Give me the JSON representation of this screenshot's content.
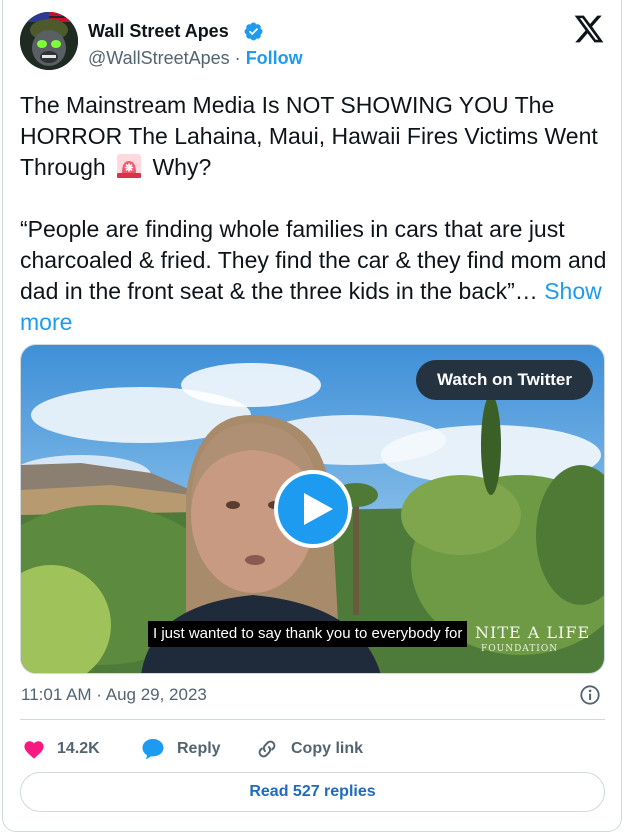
{
  "header": {
    "display_name": "Wall Street Apes",
    "handle": "@WallStreetApes",
    "separator": "·",
    "follow_label": "Follow"
  },
  "tweet": {
    "line1": "The Mainstream Media Is NOT SHOWING YOU The HORROR The Lahaina, Maui, Hawaii Fires Victims Went Through",
    "siren_icon": "police-car-light-emoji",
    "line1_end": "Why?",
    "quote": "“People are finding whole families in cars that are just charcoaled & fried. They find the car & they find mom and dad in the front seat & the three kids in the back”…",
    "show_more": "Show more"
  },
  "media": {
    "watch_label": "Watch on Twitter",
    "caption": "I just wanted to say thank you to everybody for",
    "watermark": "NITE A LIFE",
    "watermark_sub": "FOUNDATION"
  },
  "meta": {
    "timestamp": "11:01 AM · Aug 29, 2023"
  },
  "actions": {
    "likes": "14.2K",
    "reply_label": "Reply",
    "copy_link_label": "Copy link"
  },
  "footer": {
    "read_replies": "Read 527 replies"
  },
  "colors": {
    "accent": "#1d9bf0",
    "like": "#f91880",
    "text": "#0f1419",
    "muted": "#536471",
    "border": "#cfd9de"
  }
}
